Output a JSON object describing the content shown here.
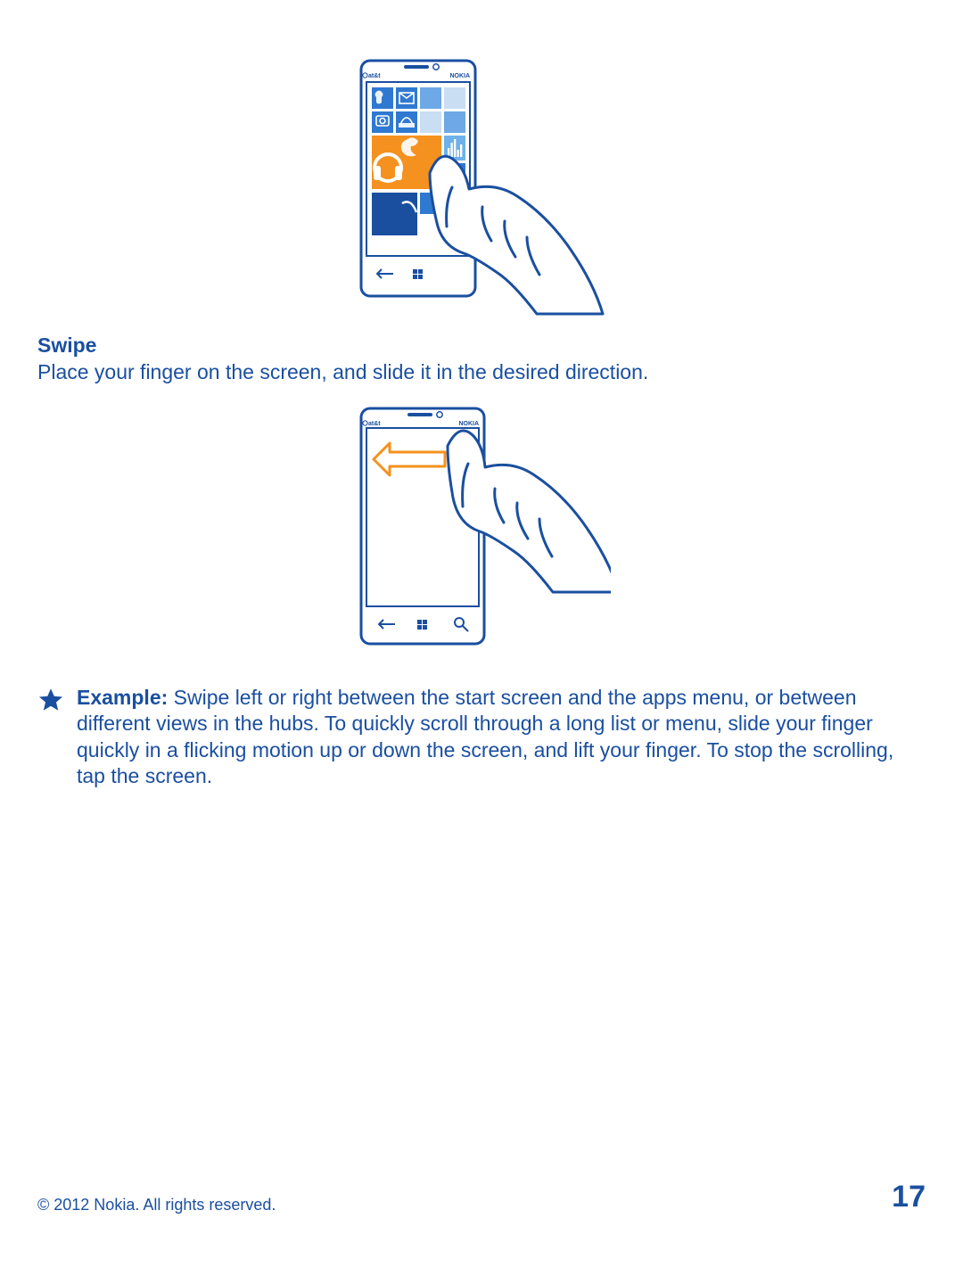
{
  "section": {
    "title": "Swipe",
    "body": "Place your finger on the screen, and slide it in the desired direction."
  },
  "callout": {
    "label": "Example:",
    "text": " Swipe left or right between the start screen and the apps menu, or between different views in the hubs. To quickly scroll through a long list or menu, slide your finger quickly in a flicking motion up or down the screen, and lift your finger. To stop the scrolling, tap the screen."
  },
  "figure1": {
    "carrier": "at&t",
    "brand": "NOKIA"
  },
  "figure2": {
    "carrier": "at&t",
    "brand": "NOKIA"
  },
  "footer": {
    "copyright": "© 2012 Nokia. All rights reserved.",
    "page_number": "17"
  }
}
